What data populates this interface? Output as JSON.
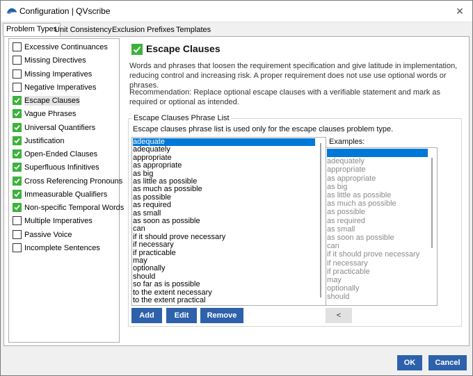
{
  "window": {
    "title": "Configuration | QVscribe",
    "close_icon": "close-icon",
    "app_icon": "qvscribe-logo-icon"
  },
  "tabs": [
    {
      "label": "Problem Types",
      "active": true
    },
    {
      "label": "Unit Consistency",
      "active": false
    },
    {
      "label": "Exclusion Prefixes",
      "active": false
    },
    {
      "label": "Templates",
      "active": false
    }
  ],
  "problem_types": [
    {
      "label": "Excessive Continuances",
      "checked": false
    },
    {
      "label": "Missing Directives",
      "checked": false
    },
    {
      "label": "Missing Imperatives",
      "checked": false
    },
    {
      "label": "Negative Imperatives",
      "checked": false
    },
    {
      "label": "Escape Clauses",
      "checked": true,
      "selected": true
    },
    {
      "label": "Vague Phrases",
      "checked": true
    },
    {
      "label": "Universal Quantifiers",
      "checked": true
    },
    {
      "label": "Justification",
      "checked": true
    },
    {
      "label": "Open-Ended Clauses",
      "checked": true
    },
    {
      "label": "Superfluous Infinitives",
      "checked": true
    },
    {
      "label": "Cross Referencing Pronouns",
      "checked": true
    },
    {
      "label": "Immeasurable Qualifiers",
      "checked": true
    },
    {
      "label": "Non-specific Temporal Words",
      "checked": true
    },
    {
      "label": "Multiple Imperatives",
      "checked": false
    },
    {
      "label": "Passive Voice",
      "checked": false
    },
    {
      "label": "Incomplete Sentences",
      "checked": false
    }
  ],
  "detail": {
    "title": "Escape Clauses",
    "enabled": true,
    "description": "Words and phrases that loosen the requirement specification and give latitude in implementation, reducing control and increasing risk. A proper requirement does not use use optional words or phrases.",
    "recommendation": "Recommendation: Replace optional escape clauses with a verifiable statement and mark as required or optional as intended.",
    "group_title": "Escape Clauses Phrase List",
    "group_description": "Escape clauses phrase list is used only for the escape clauses problem type.",
    "examples_label": "Examples:"
  },
  "phrases": [
    "adequate",
    "adequately",
    "appropriate",
    "as appropriate",
    "as big",
    "as little as possible",
    "as much as possible",
    "as possible",
    "as required",
    "as small",
    "as soon as possible",
    "can",
    "if it should prove necessary",
    "if necessary",
    "if practicable",
    "may",
    "optionally",
    "should",
    "so far as is possible",
    "to the extent necessary",
    "to the extent practical"
  ],
  "selected_phrase_index": 0,
  "examples": [
    "adequate",
    "adequately",
    "appropriate",
    "as appropriate",
    "as big",
    "as little as possible",
    "as much as possible",
    "as possible",
    "as required",
    "as small",
    "as soon as possible",
    "can",
    "if it should prove necessary",
    "if necessary",
    "if practicable",
    "may",
    "optionally",
    "should"
  ],
  "buttons": {
    "add": "Add",
    "edit": "Edit",
    "remove": "Remove",
    "move_left": "<",
    "ok": "OK",
    "cancel": "Cancel"
  },
  "colors": {
    "accent": "#2d61ab",
    "check_green": "#3cb23c",
    "selection": "#0078d7"
  }
}
